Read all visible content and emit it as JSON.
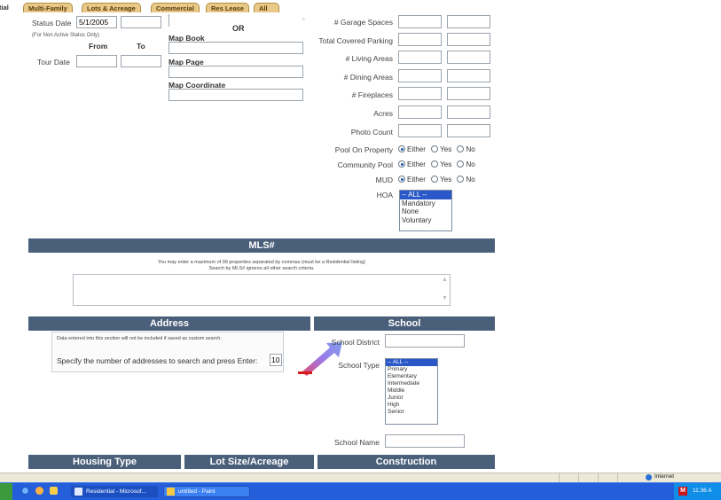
{
  "tabs": [
    {
      "label": "tial"
    },
    {
      "label": "Multi-Family"
    },
    {
      "label": "Lots & Acreage"
    },
    {
      "label": "Commercial"
    },
    {
      "label": "Res Lease"
    },
    {
      "label": "All"
    }
  ],
  "left": {
    "status_date_label": "Status Date",
    "status_date_value": "5/1/2005",
    "non_active_note": "(For Non Active Status Only)",
    "from_label": "From",
    "to_label": "To",
    "tour_date_label": "Tour Date"
  },
  "map": {
    "or_label": "OR",
    "map_book_label": "Map Book",
    "map_page_label": "Map Page",
    "map_coordinate_label": "Map Coordinate"
  },
  "right_fields": [
    {
      "label": "# Garage Spaces"
    },
    {
      "label": "Total Covered Parking"
    },
    {
      "label": "# Living Areas"
    },
    {
      "label": "# Dining Areas"
    },
    {
      "label": "# Fireplaces"
    },
    {
      "label": "Acres"
    },
    {
      "label": "Photo Count"
    }
  ],
  "radios": [
    {
      "label": "Pool On Property",
      "options": [
        "Either",
        "Yes",
        "No"
      ],
      "selected": "Either"
    },
    {
      "label": "Community Pool",
      "options": [
        "Either",
        "Yes",
        "No"
      ],
      "selected": "Either"
    },
    {
      "label": "MUD",
      "options": [
        "Either",
        "Yes",
        "No"
      ],
      "selected": "Either"
    }
  ],
  "hoa": {
    "label": "HOA",
    "options": [
      "-- ALL --",
      "Mandatory",
      "None",
      "Voluntary"
    ],
    "selected": "-- ALL --"
  },
  "mls": {
    "header": "MLS#",
    "note_line1": "You may enter a maximum of 99 properties separated by commas (must be a Residential listing)",
    "note_line2": "Search by MLS# ignores all other search criteria."
  },
  "address": {
    "header": "Address",
    "custom_note": "Data entered into this section will not be included if saved as custom search.",
    "count_prompt": "Specify the number of addresses to search and press Enter:",
    "count_value": "10"
  },
  "school": {
    "header": "School",
    "district_label": "School District",
    "type_label": "School Type",
    "type_options": [
      "-- ALL --",
      "Primary",
      "Elementary",
      "Intermediate",
      "Middle",
      "Junior",
      "High",
      "Senior"
    ],
    "type_selected": "-- ALL --",
    "name_label": "School Name"
  },
  "bottom_sections": [
    {
      "label": "Housing Type"
    },
    {
      "label": "Lot Size/Acreage"
    },
    {
      "label": "Construction"
    }
  ],
  "statusbar": {
    "zone": "Internet"
  },
  "taskbar": {
    "items": [
      {
        "label": "Residential - Microsof..."
      },
      {
        "label": "untitled - Paint"
      }
    ],
    "clock": "11:36 A"
  },
  "colors": {
    "section_header": "#4a5f7a",
    "tab_fill": "#e8c987",
    "taskbar": "#245edb",
    "selection": "#2b58c8",
    "arrow_red": "#d91c1c",
    "arrow_purple": "#8a6ee0"
  }
}
